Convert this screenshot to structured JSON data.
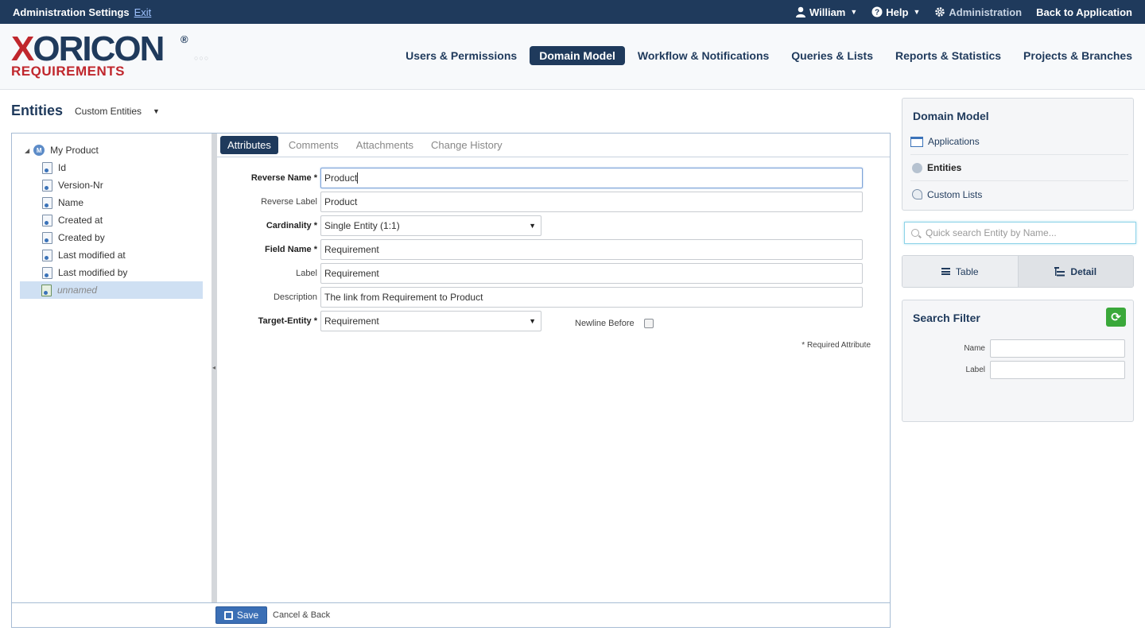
{
  "topbar": {
    "title": "Administration Settings",
    "exit": "Exit",
    "user": "William",
    "help": "Help",
    "admin": "Administration",
    "back": "Back to Application"
  },
  "logo": {
    "word_x": "X",
    "word_rest": "ORICON",
    "reg": "®",
    "sub": "REQUIREMENTS",
    "dots": "○○○"
  },
  "nav": [
    "Users & Permissions",
    "Domain Model",
    "Workflow & Notifications",
    "Queries & Lists",
    "Reports & Statistics",
    "Projects & Branches"
  ],
  "entities": {
    "title": "Entities",
    "selected": "Custom Entities",
    "caret": "▼"
  },
  "tree": {
    "root": "My Product",
    "root_icon": "M",
    "items": [
      "Id",
      "Version-Nr",
      "Name",
      "Created at",
      "Created by",
      "Last modified at",
      "Last modified by"
    ],
    "selected": "unnamed"
  },
  "tabs": [
    "Attributes",
    "Comments",
    "Attachments",
    "Change History"
  ],
  "form": {
    "reverse_name_label": "Reverse Name *",
    "reverse_name": "Product",
    "reverse_label_label": "Reverse Label",
    "reverse_label": "Product",
    "cardinality_label": "Cardinality *",
    "cardinality": "Single Entity (1:1)",
    "field_name_label": "Field Name *",
    "field_name": "Requirement",
    "label_label": "Label",
    "label": "Requirement",
    "description_label": "Description",
    "description": "The link from Requirement to Product",
    "target_entity_label": "Target-Entity *",
    "target_entity": "Requirement",
    "newline_before": "Newline Before",
    "required_note": "* Required Attribute"
  },
  "footer": {
    "save": "Save",
    "cancel": "Cancel & Back"
  },
  "domain_model": {
    "title": "Domain Model",
    "items": [
      "Applications",
      "Entities",
      "Custom Lists"
    ]
  },
  "quick_search": {
    "placeholder": "Quick search Entity by Name..."
  },
  "view": {
    "table": "Table",
    "detail": "Detail"
  },
  "search_filter": {
    "title": "Search Filter",
    "name_label": "Name",
    "label_label": "Label"
  },
  "colors": {
    "brand_navy": "#1f3a5c",
    "brand_red": "#c0272d",
    "save_blue": "#3b6fb5",
    "refresh_green": "#3aa83a"
  }
}
